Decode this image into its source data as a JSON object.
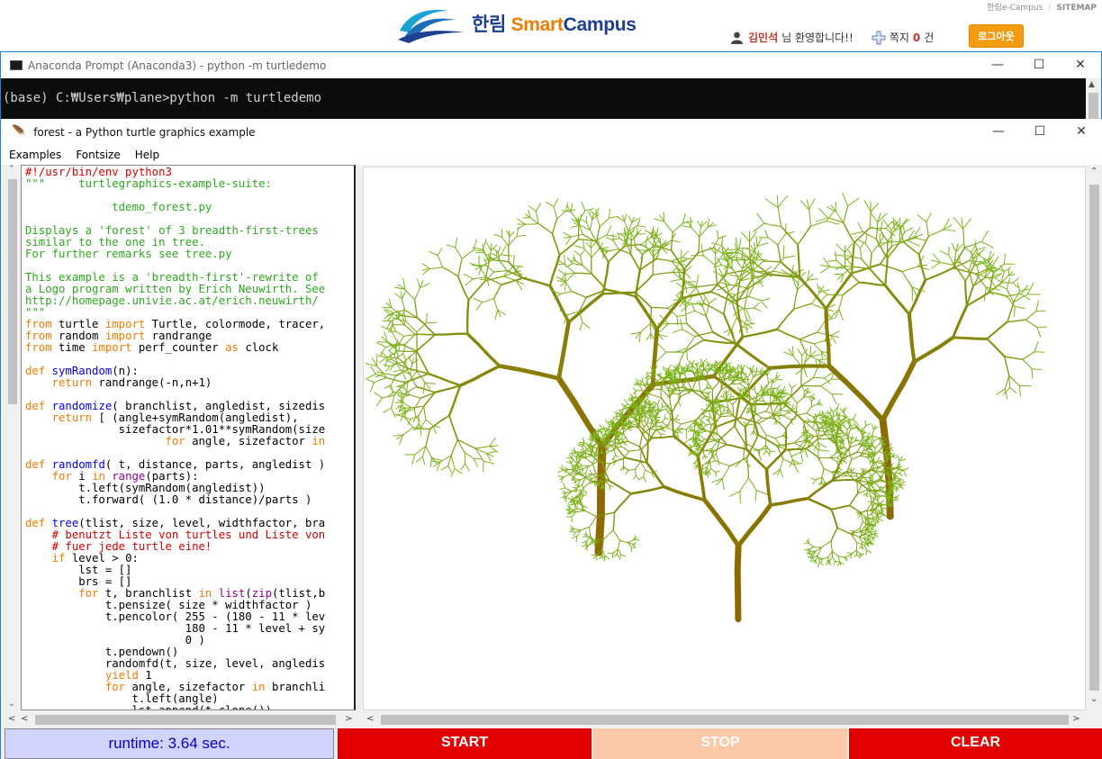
{
  "portal": {
    "toplinks": [
      "한림e-Campus",
      "SITEMAP"
    ],
    "logo_korean": "한림",
    "logo_smart": "Smart",
    "logo_campus": "Campus",
    "user_name": "김민석",
    "greeting": "님 환영합니다!!",
    "messages_label": "쪽지",
    "messages_count": "0",
    "messages_unit": "건",
    "logout_label": "로그아웃"
  },
  "conda": {
    "title": "Anaconda Prompt (Anaconda3) - python  -m turtledemo",
    "prompt_line": "(base) C:₩Users₩plane>python -m turtledemo"
  },
  "demo": {
    "title": "forest - a Python turtle graphics example",
    "menu": [
      "Examples",
      "Fontsize",
      "Help"
    ],
    "code_lines": [
      [
        [
          "c-com",
          "#!/usr/bin/env python3"
        ]
      ],
      [
        [
          "c-str",
          "\"\"\"     turtlegraphics-example-suite:"
        ]
      ],
      [
        [
          "c-str",
          ""
        ]
      ],
      [
        [
          "c-str",
          "             tdemo_forest.py"
        ]
      ],
      [
        [
          "c-str",
          ""
        ]
      ],
      [
        [
          "c-str",
          "Displays a 'forest' of 3 breadth-first-trees"
        ]
      ],
      [
        [
          "c-str",
          "similar to the one in tree."
        ]
      ],
      [
        [
          "c-str",
          "For further remarks see tree.py"
        ]
      ],
      [
        [
          "c-str",
          ""
        ]
      ],
      [
        [
          "c-str",
          "This example is a 'breadth-first'-rewrite of"
        ]
      ],
      [
        [
          "c-str",
          "a Logo program written by Erich Neuwirth. See"
        ]
      ],
      [
        [
          "c-str",
          "http://homepage.univie.ac.at/erich.neuwirth/"
        ]
      ],
      [
        [
          "c-str",
          "\"\"\""
        ]
      ],
      [
        [
          "c-kw",
          "from"
        ],
        [
          "",
          " turtle "
        ],
        [
          "c-kw",
          "import"
        ],
        [
          "",
          " Turtle, colormode, tracer,"
        ]
      ],
      [
        [
          "c-kw",
          "from"
        ],
        [
          "",
          " random "
        ],
        [
          "c-kw",
          "import"
        ],
        [
          "",
          " randrange"
        ]
      ],
      [
        [
          "c-kw",
          "from"
        ],
        [
          "",
          " time "
        ],
        [
          "c-kw",
          "import"
        ],
        [
          "",
          " perf_counter "
        ],
        [
          "c-kw",
          "as"
        ],
        [
          "",
          " clock"
        ]
      ],
      [
        [
          "",
          ""
        ]
      ],
      [
        [
          "c-kw",
          "def"
        ],
        [
          "",
          " "
        ],
        [
          "c-def",
          "symRandom"
        ],
        [
          "",
          "(n):"
        ]
      ],
      [
        [
          "",
          "    "
        ],
        [
          "c-kw",
          "return"
        ],
        [
          "",
          " randrange(-n,n+1)"
        ]
      ],
      [
        [
          "",
          ""
        ]
      ],
      [
        [
          "c-kw",
          "def"
        ],
        [
          "",
          " "
        ],
        [
          "c-def",
          "randomize"
        ],
        [
          "",
          "( branchlist, angledist, sizedis"
        ]
      ],
      [
        [
          "",
          "    "
        ],
        [
          "c-kw",
          "return"
        ],
        [
          "",
          " [ (angle+symRandom(angledist),"
        ]
      ],
      [
        [
          "",
          "              sizefactor*1.01**symRandom(size"
        ]
      ],
      [
        [
          "",
          "                     "
        ],
        [
          "c-kw",
          "for"
        ],
        [
          "",
          " angle, sizefactor "
        ],
        [
          "c-kw",
          "in"
        ]
      ],
      [
        [
          "",
          ""
        ]
      ],
      [
        [
          "c-kw",
          "def"
        ],
        [
          "",
          " "
        ],
        [
          "c-def",
          "randomfd"
        ],
        [
          "",
          "( t, distance, parts, angledist )"
        ]
      ],
      [
        [
          "",
          "    "
        ],
        [
          "c-kw",
          "for"
        ],
        [
          "",
          " i "
        ],
        [
          "c-kw",
          "in"
        ],
        [
          "",
          " "
        ],
        [
          "c-bi",
          "range"
        ],
        [
          "",
          "(parts):"
        ]
      ],
      [
        [
          "",
          "        t.left(symRandom(angledist))"
        ]
      ],
      [
        [
          "",
          "        t.forward( (1.0 * distance)/parts )"
        ]
      ],
      [
        [
          "",
          ""
        ]
      ],
      [
        [
          "c-kw",
          "def"
        ],
        [
          "",
          " "
        ],
        [
          "c-def",
          "tree"
        ],
        [
          "",
          "(tlist, size, level, widthfactor, bra"
        ]
      ],
      [
        [
          "",
          "    "
        ],
        [
          "c-com",
          "# benutzt Liste von turtles und Liste von"
        ]
      ],
      [
        [
          "",
          "    "
        ],
        [
          "c-com",
          "# fuer jede turtle eine!"
        ]
      ],
      [
        [
          "",
          "    "
        ],
        [
          "c-kw",
          "if"
        ],
        [
          "",
          " level > 0:"
        ]
      ],
      [
        [
          "",
          "        lst = []"
        ]
      ],
      [
        [
          "",
          "        brs = []"
        ]
      ],
      [
        [
          "",
          "        "
        ],
        [
          "c-kw",
          "for"
        ],
        [
          "",
          " t, branchlist "
        ],
        [
          "c-kw",
          "in"
        ],
        [
          "",
          " "
        ],
        [
          "c-bi",
          "list"
        ],
        [
          "",
          "("
        ],
        [
          "c-bi",
          "zip"
        ],
        [
          "",
          "(tlist,b"
        ]
      ],
      [
        [
          "",
          "            t.pensize( size * widthfactor )"
        ]
      ],
      [
        [
          "",
          "            t.pencolor( 255 - (180 - 11 * lev"
        ]
      ],
      [
        [
          "",
          "                        180 - 11 * level + sy"
        ]
      ],
      [
        [
          "",
          "                        0 )"
        ]
      ],
      [
        [
          "",
          "            t.pendown()"
        ]
      ],
      [
        [
          "",
          "            randomfd(t, size, level, angledis"
        ]
      ],
      [
        [
          "",
          "            "
        ],
        [
          "c-kw",
          "yield"
        ],
        [
          "",
          " 1"
        ]
      ],
      [
        [
          "",
          "            "
        ],
        [
          "c-kw",
          "for"
        ],
        [
          "",
          " angle, sizefactor "
        ],
        [
          "c-kw",
          "in"
        ],
        [
          "",
          " branchli"
        ]
      ],
      [
        [
          "",
          "                t.left(angle)"
        ]
      ],
      [
        [
          "",
          "                lst.append(t.clone())"
        ]
      ]
    ],
    "runtime": "runtime: 3.64 sec.",
    "start_label": "START",
    "stop_label": "STOP",
    "clear_label": "CLEAR"
  },
  "colors": {
    "string": "#2ea71f",
    "comment": "#d40000",
    "keyword": "#f07c00",
    "definition": "#0000ee",
    "builtin": "#900090",
    "button_red": "#e30000",
    "button_disabled": "#fbc9a8",
    "runtime_bg": "#d3d3ff",
    "trunk": "#8c6a00",
    "leaf": "#7bb51a"
  }
}
